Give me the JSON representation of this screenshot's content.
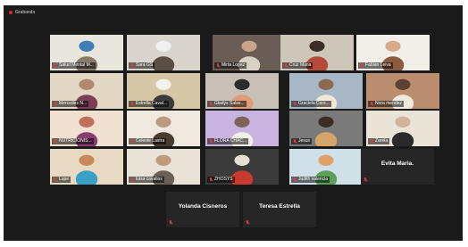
{
  "recording": {
    "label": "Grabando"
  },
  "colors": {
    "active_outline": "#a7d94a",
    "muted_mic": "#e03a3a",
    "background": "#1a1a1a"
  },
  "participants": [
    {
      "name": "Salud Mental M...",
      "muted": true,
      "video": true,
      "active": true
    },
    {
      "name": "Sara GS",
      "muted": true,
      "video": true
    },
    {
      "name": "Mirta Lopez",
      "muted": true,
      "video": true
    },
    {
      "name": "Cruz Maria",
      "muted": true,
      "video": true
    },
    {
      "name": "Fabian Leiva",
      "muted": true,
      "video": true
    },
    {
      "name": "Mercedes N...",
      "muted": true,
      "video": true
    },
    {
      "name": "Estrella Caval...",
      "muted": true,
      "video": true
    },
    {
      "name": "Gladys Salas...",
      "muted": true,
      "video": true
    },
    {
      "name": "Graciela Cors...",
      "muted": true,
      "video": true
    },
    {
      "name": "Nora mendez",
      "muted": true,
      "video": true
    },
    {
      "name": "NUTRICIONIS...",
      "muted": true,
      "video": true
    },
    {
      "name": "Celeste Lastra",
      "muted": true,
      "video": true
    },
    {
      "name": "FLORA CHAC...",
      "muted": true,
      "video": true
    },
    {
      "name": "Jesus",
      "muted": true,
      "video": true
    },
    {
      "name": "Zarela",
      "muted": true,
      "video": true
    },
    {
      "name": "Lupe",
      "muted": true,
      "video": true
    },
    {
      "name": "luisa cavallos",
      "muted": true,
      "video": true
    },
    {
      "name": "ZHOSYS",
      "muted": true,
      "video": true
    },
    {
      "name": "Judith valencia",
      "muted": true,
      "video": true
    },
    {
      "name": "Evita Maria.",
      "muted": true,
      "video": false
    },
    {
      "name": "Yolanda Cisneros",
      "muted": true,
      "video": false
    },
    {
      "name": "Teresa Estrella",
      "muted": true,
      "video": false
    }
  ]
}
